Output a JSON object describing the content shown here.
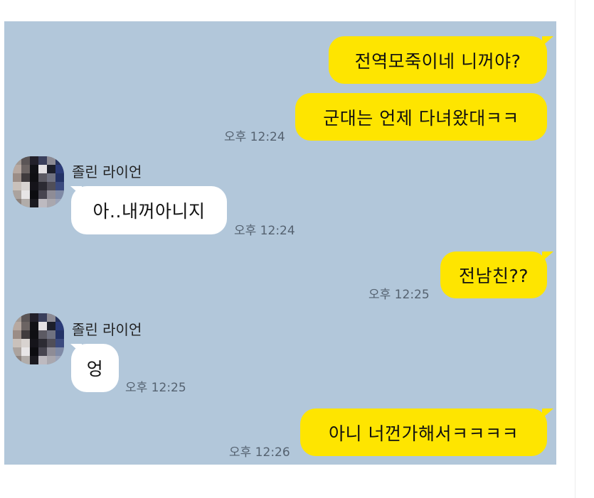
{
  "messages": [
    {
      "side": "me",
      "text": "전역모죽이네 니꺼야?"
    },
    {
      "side": "me",
      "text": "군대는 언제 다녀왔대ㅋㅋ",
      "time": "오후 12:24"
    },
    {
      "side": "other",
      "sender": "졸린 라이언",
      "text": "아..내꺼아니지",
      "time": "오후 12:24"
    },
    {
      "side": "me",
      "text": "전남친??",
      "time": "오후 12:25"
    },
    {
      "side": "other",
      "sender": "졸린 라이언",
      "text": "엉",
      "time": "오후 12:25"
    },
    {
      "side": "me",
      "text": "아니 너껀가해서ㅋㅋㅋㅋ",
      "time": "오후 12:26"
    }
  ],
  "colors": {
    "chat_background": "#b2c7da",
    "my_bubble": "#fee500",
    "other_bubble": "#ffffff"
  }
}
